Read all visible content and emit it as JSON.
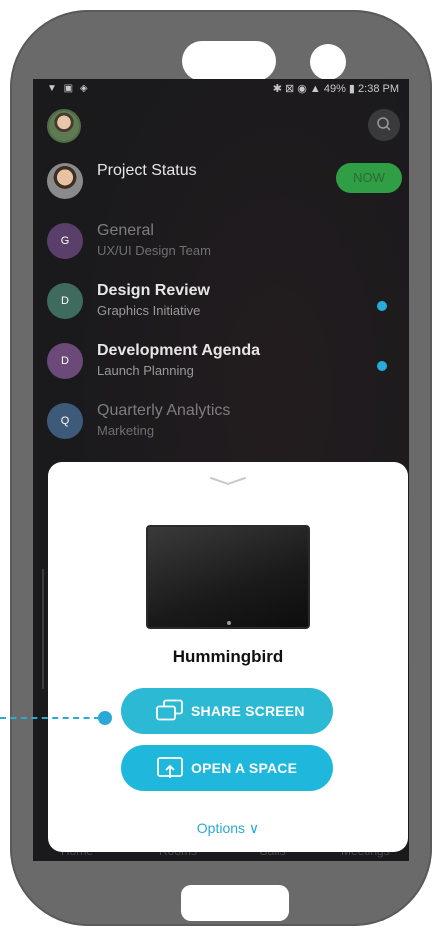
{
  "status_bar": {
    "left_icons": "▼ ▣ ◈",
    "right_text": "✱ ⊠ ◉ ▲ 49% ▮ 2:38 PM"
  },
  "list": [
    {
      "initial": "",
      "title": "Project Status",
      "subtitle": "",
      "badge": "NOW",
      "color": "#8a8a8a"
    },
    {
      "initial": "G",
      "title": "General",
      "subtitle": "UX/UI Design Team",
      "color": "#6a4f7a"
    },
    {
      "initial": "D",
      "title": "Design Review",
      "subtitle": "Graphics Initiative",
      "color": "#3f6b5e"
    },
    {
      "initial": "D",
      "title": "Development Agenda",
      "subtitle": "Launch Planning",
      "color": "#6b4a7a"
    },
    {
      "initial": "Q",
      "title": "Quarterly Analytics",
      "subtitle": "Marketing",
      "color": "#3e5a7a"
    }
  ],
  "tabs": [
    "Home",
    "Rooms",
    "Calls",
    "Meetings"
  ],
  "sheet": {
    "device_name": "Hummingbird",
    "share_screen_label": "SHARE SCREEN",
    "open_space_label": "OPEN A SPACE",
    "options_label": "Options ∨"
  },
  "colors": {
    "accent": "#2cb9d4",
    "now_green": "#2f9e45",
    "unread_dot": "#24aed6"
  },
  "icons": [
    "search-icon",
    "chevron-down-icon",
    "share-screen-icon",
    "open-space-icon"
  ]
}
